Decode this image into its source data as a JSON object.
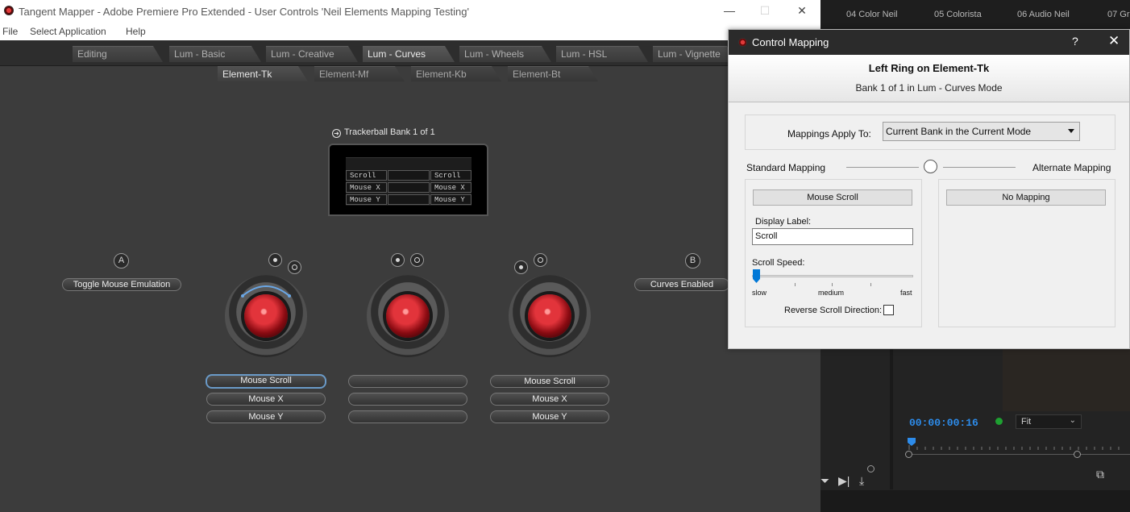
{
  "premiere": {
    "tabs": [
      "04 Color Neil",
      "05 Colorista",
      "06 Audio Neil",
      "07 Gr"
    ],
    "timecode": "00:00:00:16",
    "fit_label": "Fit"
  },
  "window": {
    "title": "Tangent Mapper - Adobe Premiere Pro Extended - User Controls 'Neil Elements Mapping Testing'",
    "minimize": "—",
    "maximize": "☐",
    "close": "✕"
  },
  "menu": {
    "items": [
      "File",
      "Select Application",
      "Help"
    ]
  },
  "mode_tabs": [
    {
      "label": "Editing",
      "active": false
    },
    {
      "label": "Lum - Basic",
      "active": false
    },
    {
      "label": "Lum - Creative",
      "active": false
    },
    {
      "label": "Lum - Curves",
      "active": true
    },
    {
      "label": "Lum - Wheels",
      "active": false
    },
    {
      "label": "Lum - HSL",
      "active": false
    },
    {
      "label": "Lum - Vignette",
      "active": false
    }
  ],
  "element_tabs": [
    {
      "label": "Element-Tk",
      "active": true
    },
    {
      "label": "Element-Mf",
      "active": false
    },
    {
      "label": "Element-Kb",
      "active": false
    },
    {
      "label": "Element-Bt",
      "active": false
    }
  ],
  "trackerball_bank": {
    "label": "Trackerball Bank 1 of 1",
    "cells": {
      "l1": "Scroll",
      "r1": "Scroll",
      "l2": "Mouse X",
      "r2": "Mouse X",
      "l3": "Mouse Y",
      "r3": "Mouse Y"
    }
  },
  "panel": {
    "button_a": "A",
    "button_b": "B",
    "button_a_label": "Toggle Mouse Emulation",
    "button_b_label": "Curves Enabled",
    "ball1": [
      "Mouse Scroll",
      "Mouse X",
      "Mouse Y"
    ],
    "ball2": [
      "",
      "",
      ""
    ],
    "ball3": [
      "Mouse Scroll",
      "Mouse X",
      "Mouse Y"
    ]
  },
  "dialog": {
    "title": "Control Mapping",
    "help": "?",
    "close": "✕",
    "heading": "Left Ring on Element-Tk",
    "subheading": "Bank 1 of 1 in Lum - Curves Mode",
    "apply_label": "Mappings Apply To:",
    "apply_value": "Current Bank in the Current Mode",
    "standard_label": "Standard Mapping",
    "alternate_label": "Alternate Mapping",
    "standard_button": "Mouse Scroll",
    "alternate_button": "No Mapping",
    "display_label": "Display Label:",
    "display_value": "Scroll",
    "scroll_speed_label": "Scroll Speed:",
    "speed_slow": "slow",
    "speed_medium": "medium",
    "speed_fast": "fast",
    "reverse_label": "Reverse Scroll Direction:",
    "reverse_checked": false
  }
}
